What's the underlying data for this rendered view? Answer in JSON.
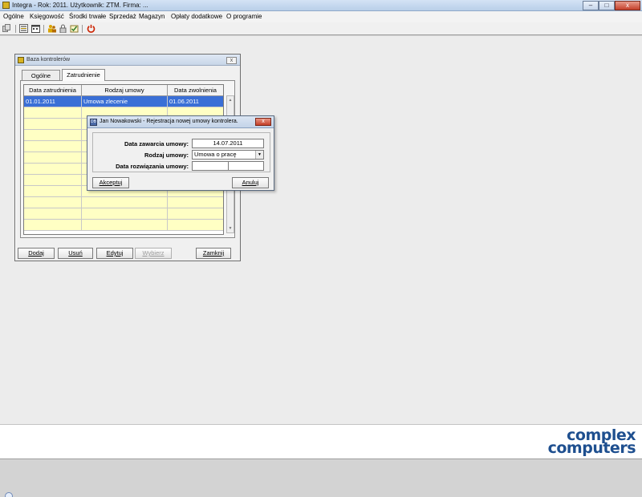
{
  "app": {
    "title": "Integra -  Rok: 2011. Użytkownik: ZTM. Firma: ...",
    "controls": {
      "minimize": "–",
      "maximize": "□",
      "close": "x"
    }
  },
  "menu": [
    {
      "label": "Ogólne"
    },
    {
      "label": "Księgowość"
    },
    {
      "label": "Środki trwałe"
    },
    {
      "label": "Sprzedaż"
    },
    {
      "label": "Magazyn"
    },
    {
      "label": "Opłaty dodatkowe"
    },
    {
      "label": "O programie"
    }
  ],
  "toolbar": {
    "icons": [
      "copy-icon",
      "list-icon",
      "calendar-icon",
      "users-icon",
      "lock-icon",
      "check-icon",
      "power-icon"
    ],
    "colors": {
      "power": "#cc2200",
      "users": "#d9a300"
    }
  },
  "baza": {
    "title": "Baza kontrolerów",
    "close": "x",
    "tabs": [
      {
        "label": "Ogólne"
      },
      {
        "label": "Zatrudnienie"
      }
    ],
    "columns": [
      "Data zatrudnienia",
      "Rodzaj umowy",
      "Data zwolnienia"
    ],
    "rows": [
      [
        "01.01.2011",
        "Umowa zlecenie",
        "01.06.2011"
      ],
      [
        "",
        "",
        ""
      ],
      [
        "",
        "",
        ""
      ],
      [
        "",
        "",
        ""
      ],
      [
        "",
        "",
        ""
      ],
      [
        "",
        "",
        ""
      ],
      [
        "",
        "",
        ""
      ],
      [
        "",
        "",
        ""
      ],
      [
        "",
        "",
        ""
      ],
      [
        "",
        "",
        ""
      ],
      [
        "",
        "",
        ""
      ],
      [
        "",
        "",
        ""
      ]
    ],
    "buttons": {
      "add": "Dodaj",
      "delete": "Usuń",
      "edit": "Edytuj",
      "select": "Wybierz",
      "close": "Zamknij"
    }
  },
  "dialog": {
    "title": "Jan Nowakowski - Rejestracja nowej umowy kontrolera.",
    "icon_label": "DB",
    "close": "x",
    "fields": {
      "date_signed_label": "Data zawarcia umowy:",
      "date_signed_value": "14.07.2011",
      "contract_type_label": "Rodzaj umowy:",
      "contract_type_value": "Umowa o pracę",
      "date_end_label": "Data rozwiązania umowy:",
      "date_end_value": ""
    },
    "buttons": {
      "accept": "Akceptuj",
      "cancel": "Anuluj"
    }
  },
  "branding": {
    "line1": "complex",
    "line2": "computers",
    "color": "#1e4f8f"
  }
}
